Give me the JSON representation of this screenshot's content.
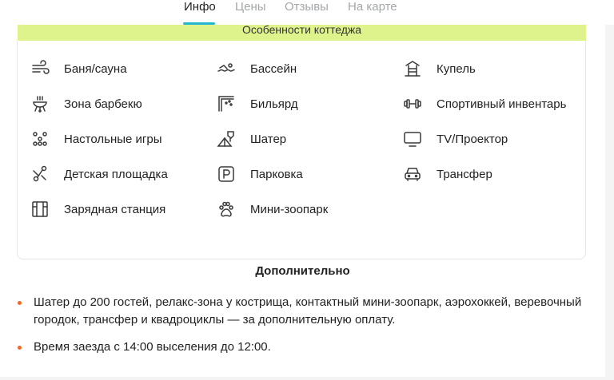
{
  "tabs": [
    {
      "label": "Инфо",
      "active": true
    },
    {
      "label": "Цены",
      "active": false
    },
    {
      "label": "Отзывы",
      "active": false
    },
    {
      "label": "На карте",
      "active": false
    }
  ],
  "features": {
    "title": "Особенности коттеджа",
    "items": [
      {
        "label": "Баня/сауна",
        "icon": "sauna-icon"
      },
      {
        "label": "Бассейн",
        "icon": "pool-icon"
      },
      {
        "label": "Купель",
        "icon": "hot-tub-icon"
      },
      {
        "label": "Зона барбекю",
        "icon": "bbq-icon"
      },
      {
        "label": "Бильярд",
        "icon": "billiards-icon"
      },
      {
        "label": "Спортивный инвентарь",
        "icon": "dumbbell-icon"
      },
      {
        "label": "Настольные игры",
        "icon": "board-games-icon"
      },
      {
        "label": "Шатер",
        "icon": "tent-icon"
      },
      {
        "label": "TV/Проектор",
        "icon": "tv-icon"
      },
      {
        "label": "Детская площадка",
        "icon": "playground-icon"
      },
      {
        "label": "Парковка",
        "icon": "parking-icon"
      },
      {
        "label": "Трансфер",
        "icon": "car-icon"
      },
      {
        "label": "Зарядная станция",
        "icon": "charging-station-icon"
      },
      {
        "label": "Мини-зоопарк",
        "icon": "paw-icon"
      }
    ]
  },
  "extra": {
    "title": "Дополнительно",
    "bullets": [
      "Шатер до 200 гостей, релакс-зона у кострища, контактный мини-зоопарк, аэрохоккей, веревочный городок, трансфер и квадроциклы — за дополнительную оплату.",
      "Время заезда с 14:00 выселения до 12:00."
    ]
  },
  "colors": {
    "accent": "#25b6cf",
    "banner": "#dff38c",
    "bullet": "#ee6a2b"
  }
}
